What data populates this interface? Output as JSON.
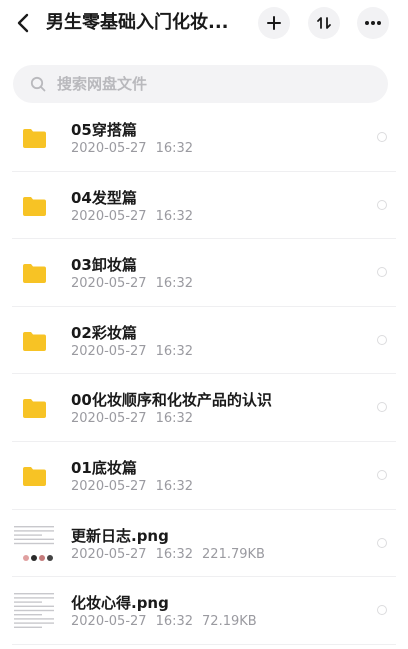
{
  "header": {
    "title": "男生零基础入门化妆...",
    "back_icon": "chevron-left-icon",
    "add_icon": "plus-icon",
    "sort_icon": "sort-icon",
    "more_icon": "more-icon"
  },
  "search": {
    "placeholder": "搜索网盘文件"
  },
  "files": [
    {
      "name": "05穿搭篇",
      "date": "2020-05-27",
      "time": "16:32",
      "size": "",
      "type": "folder"
    },
    {
      "name": "04发型篇",
      "date": "2020-05-27",
      "time": "16:32",
      "size": "",
      "type": "folder"
    },
    {
      "name": "03卸妆篇",
      "date": "2020-05-27",
      "time": "16:32",
      "size": "",
      "type": "folder"
    },
    {
      "name": "02彩妆篇",
      "date": "2020-05-27",
      "time": "16:32",
      "size": "",
      "type": "folder"
    },
    {
      "name": "00化妆顺序和化妆产品的认识",
      "date": "2020-05-27",
      "time": "16:32",
      "size": "",
      "type": "folder"
    },
    {
      "name": "01底妆篇",
      "date": "2020-05-27",
      "time": "16:32",
      "size": "",
      "type": "folder"
    },
    {
      "name": "更新日志.png",
      "date": "2020-05-27",
      "time": "16:32",
      "size": "221.79KB",
      "type": "image"
    },
    {
      "name": "化妆心得.png",
      "date": "2020-05-27",
      "time": "16:32",
      "size": "72.19KB",
      "type": "image"
    }
  ],
  "colors": {
    "folder": "#f7c325",
    "accent": "#1a1a1a",
    "meta": "#9a9aa0"
  }
}
